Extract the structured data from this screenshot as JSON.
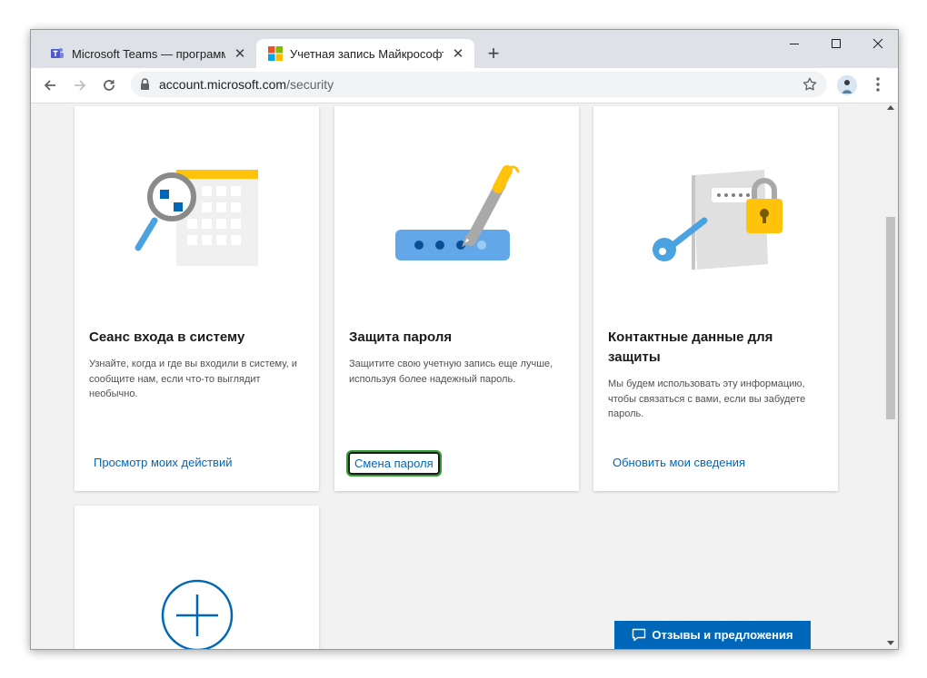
{
  "browser": {
    "tabs": [
      {
        "title": "Microsoft Teams — программа д",
        "active": false
      },
      {
        "title": "Учетная запись Майкрософт | S",
        "active": true
      }
    ],
    "new_tab_label": "+",
    "url_host": "account.microsoft.com",
    "url_path": "/security"
  },
  "cards": [
    {
      "title": "Сеанс входа в систему",
      "description": "Узнайте, когда и где вы входили в систему, и сообщите нам, если что-то выглядит необычно.",
      "link": "Просмотр моих действий"
    },
    {
      "title": "Защита пароля",
      "description": "Защитите свою учетную запись еще лучше, используя более надежный пароль.",
      "link": "Смена пароля"
    },
    {
      "title": "Контактные данные для защиты",
      "description": "Мы будем использовать эту информацию, чтобы связаться с вами, если вы забудете пароль.",
      "link": "Обновить мои сведения"
    }
  ],
  "feedback_button": "Отзывы и предложения",
  "colors": {
    "accent": "#0067b8",
    "focus_ring": "#2e9e2e",
    "illustration_yellow": "#ffc30b",
    "illustration_blue": "#4aa3e0"
  },
  "icons": [
    "teams-icon",
    "microsoft-logo-icon",
    "back-icon",
    "forward-icon",
    "reload-icon",
    "lock-icon",
    "star-icon",
    "menu-icon",
    "plus-circle-icon",
    "feedback-icon"
  ]
}
